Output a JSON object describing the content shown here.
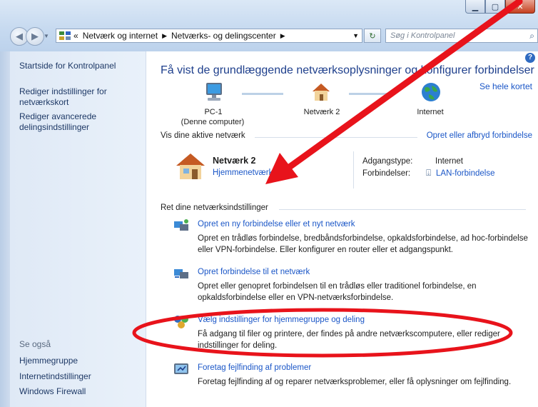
{
  "address_bar": {
    "overflow": "«",
    "crumbs": [
      "Netværk og internet",
      "Netværks- og delingscenter"
    ],
    "search_placeholder": "Søg i Kontrolpanel"
  },
  "left_pane": {
    "links": [
      "Startside for Kontrolpanel",
      "Rediger indstillinger for netværkskort",
      "Rediger avancerede delingsindstillinger"
    ],
    "see_also_label": "Se også",
    "see_also": [
      "Hjemmegruppe",
      "Internetindstillinger",
      "Windows Firewall"
    ]
  },
  "main": {
    "title": "Få vist de grundlæggende netværksoplysninger og konfigurer forbindelser",
    "see_full_map": "Se hele kortet",
    "map_nodes": {
      "pc": "PC-1",
      "pc_sub": "(Denne computer)",
      "network": "Netværk 2",
      "internet": "Internet"
    },
    "active_networks": {
      "heading": "Vis dine aktive netværk",
      "link": "Opret eller afbryd forbindelse",
      "network_name": "Netværk 2",
      "network_type": "Hjemmenetværk",
      "access_type_label": "Adgangstype:",
      "access_type_value": "Internet",
      "connections_label": "Forbindelser:",
      "connections_value": "LAN-forbindelse"
    },
    "change_settings": {
      "heading": "Ret dine netværksindstillinger",
      "tasks": [
        {
          "title": "Opret en ny forbindelse eller et nyt netværk",
          "desc": "Opret en trådløs forbindelse, bredbåndsforbindelse, opkaldsforbindelse, ad hoc-forbindelse eller VPN-forbindelse. Eller konfigurer en router eller et adgangspunkt."
        },
        {
          "title": "Opret forbindelse til et netværk",
          "desc": "Opret eller genopret forbindelsen til en trådløs eller traditionel forbindelse, en opkaldsforbindelse eller en VPN-netværksforbindelse."
        },
        {
          "title": "Vælg indstillinger for hjemmegruppe og deling",
          "desc": "Få adgang til filer og printere, der findes på andre netværkscomputere, eller rediger indstillinger for deling."
        },
        {
          "title": "Foretag fejlfinding af problemer",
          "desc": "Foretag fejlfinding af og reparer netværksproblemer, eller få oplysninger om fejlfinding."
        }
      ]
    }
  },
  "colors": {
    "link": "#1a56c7",
    "title": "#1e3f8c",
    "annotation": "#e8131b"
  }
}
